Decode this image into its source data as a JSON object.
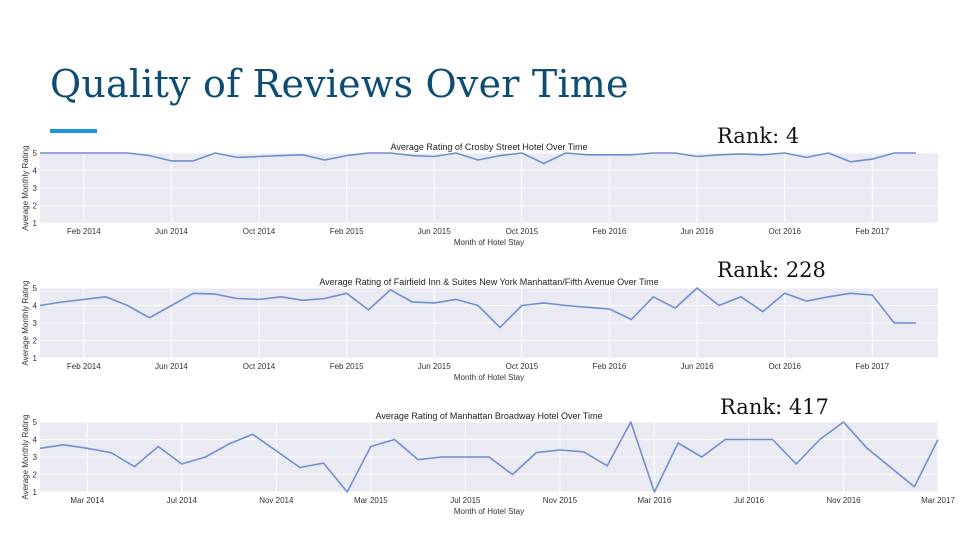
{
  "slide": {
    "title": "Quality of Reviews Over Time",
    "accent_color": "#1a9ad6",
    "title_color": "#0d4c73"
  },
  "ranks": [
    "Rank: 4",
    "Rank: 228",
    "Rank: 417"
  ],
  "chart_data": [
    {
      "type": "line",
      "title": "Average Rating of Crosby Street Hotel Over Time",
      "xlabel": "Month of Hotel Stay",
      "ylabel": "Average Monthly Rating",
      "ylim": [
        1,
        5
      ],
      "yticks": [
        1,
        2,
        3,
        4,
        5
      ],
      "xrange": [
        "2013-12",
        "2017-05"
      ],
      "xticks": [
        {
          "month": "2014-02",
          "label": "Feb 2014"
        },
        {
          "month": "2014-06",
          "label": "Jun 2014"
        },
        {
          "month": "2014-10",
          "label": "Oct 2014"
        },
        {
          "month": "2015-02",
          "label": "Feb 2015"
        },
        {
          "month": "2015-06",
          "label": "Jun 2015"
        },
        {
          "month": "2015-10",
          "label": "Oct 2015"
        },
        {
          "month": "2016-02",
          "label": "Feb 2016"
        },
        {
          "month": "2016-06",
          "label": "Jun 2016"
        },
        {
          "month": "2016-10",
          "label": "Oct 2016"
        },
        {
          "month": "2017-02",
          "label": "Feb 2017"
        }
      ],
      "grid": true,
      "line_color": "#6f8fce",
      "background": "#eaeaf2",
      "x": [
        "2013-12",
        "2014-01",
        "2014-02",
        "2014-03",
        "2014-04",
        "2014-05",
        "2014-06",
        "2014-07",
        "2014-08",
        "2014-09",
        "2014-10",
        "2014-11",
        "2014-12",
        "2015-01",
        "2015-02",
        "2015-03",
        "2015-04",
        "2015-05",
        "2015-06",
        "2015-07",
        "2015-08",
        "2015-09",
        "2015-10",
        "2015-11",
        "2015-12",
        "2016-01",
        "2016-02",
        "2016-03",
        "2016-04",
        "2016-05",
        "2016-06",
        "2016-07",
        "2016-08",
        "2016-09",
        "2016-10",
        "2016-11",
        "2016-12",
        "2017-01",
        "2017-02",
        "2017-03",
        "2017-04"
      ],
      "values": [
        5.0,
        5.0,
        5.0,
        5.0,
        5.0,
        4.85,
        4.55,
        4.55,
        5.0,
        4.75,
        4.8,
        4.85,
        4.9,
        4.6,
        4.85,
        5.0,
        5.0,
        4.85,
        4.8,
        5.0,
        4.6,
        4.85,
        5.0,
        4.4,
        5.0,
        4.9,
        4.9,
        4.9,
        5.0,
        5.0,
        4.8,
        4.9,
        4.95,
        4.9,
        5.0,
        4.75,
        5.0,
        4.5,
        4.65,
        5.0,
        5.0
      ]
    },
    {
      "type": "line",
      "title": "Average Rating of Fairfield Inn & Suites New York Manhattan/Fifth Avenue Over Time",
      "xlabel": "Month of Hotel Stay",
      "ylabel": "Average Monthly Rating",
      "ylim": [
        1,
        5
      ],
      "yticks": [
        1,
        2,
        3,
        4,
        5
      ],
      "xrange": [
        "2013-12",
        "2017-05"
      ],
      "xticks": [
        {
          "month": "2014-02",
          "label": "Feb 2014"
        },
        {
          "month": "2014-06",
          "label": "Jun 2014"
        },
        {
          "month": "2014-10",
          "label": "Oct 2014"
        },
        {
          "month": "2015-02",
          "label": "Feb 2015"
        },
        {
          "month": "2015-06",
          "label": "Jun 2015"
        },
        {
          "month": "2015-10",
          "label": "Oct 2015"
        },
        {
          "month": "2016-02",
          "label": "Feb 2016"
        },
        {
          "month": "2016-06",
          "label": "Jun 2016"
        },
        {
          "month": "2016-10",
          "label": "Oct 2016"
        },
        {
          "month": "2017-02",
          "label": "Feb 2017"
        }
      ],
      "grid": true,
      "line_color": "#6f8fce",
      "background": "#eaeaf2",
      "x": [
        "2013-12",
        "2014-01",
        "2014-02",
        "2014-03",
        "2014-04",
        "2014-05",
        "2014-06",
        "2014-07",
        "2014-08",
        "2014-09",
        "2014-10",
        "2014-11",
        "2014-12",
        "2015-01",
        "2015-02",
        "2015-03",
        "2015-04",
        "2015-05",
        "2015-06",
        "2015-07",
        "2015-08",
        "2015-09",
        "2015-10",
        "2015-11",
        "2015-12",
        "2016-01",
        "2016-02",
        "2016-03",
        "2016-04",
        "2016-05",
        "2016-06",
        "2016-07",
        "2016-08",
        "2016-09",
        "2016-10",
        "2016-11",
        "2016-12",
        "2017-01",
        "2017-02",
        "2017-03",
        "2017-04"
      ],
      "values": [
        4.0,
        4.2,
        4.35,
        4.5,
        4.0,
        3.3,
        4.0,
        4.7,
        4.65,
        4.4,
        4.35,
        4.5,
        4.3,
        4.4,
        4.7,
        3.75,
        4.9,
        4.2,
        4.15,
        4.35,
        4.0,
        2.75,
        4.0,
        4.15,
        4.0,
        3.9,
        3.8,
        3.2,
        4.5,
        3.85,
        5.0,
        4.0,
        4.5,
        3.65,
        4.7,
        4.25,
        4.5,
        4.7,
        4.6,
        3.0,
        3.0
      ]
    },
    {
      "type": "line",
      "title": "Average Rating of Manhattan Broadway Hotel Over Time",
      "xlabel": "Month of Hotel Stay",
      "ylabel": "Average Monthly Rating",
      "ylim": [
        1,
        5
      ],
      "yticks": [
        1,
        2,
        3,
        4,
        5
      ],
      "xrange": [
        "2014-01",
        "2017-03"
      ],
      "xticks": [
        {
          "month": "2014-03",
          "label": "Mar 2014"
        },
        {
          "month": "2014-07",
          "label": "Jul 2014"
        },
        {
          "month": "2014-11",
          "label": "Nov 2014"
        },
        {
          "month": "2015-03",
          "label": "Mar 2015"
        },
        {
          "month": "2015-07",
          "label": "Jul 2015"
        },
        {
          "month": "2015-11",
          "label": "Nov 2015"
        },
        {
          "month": "2016-03",
          "label": "Mar 2016"
        },
        {
          "month": "2016-07",
          "label": "Jul 2016"
        },
        {
          "month": "2016-11",
          "label": "Nov 2016"
        },
        {
          "month": "2017-03",
          "label": "Mar 2017"
        }
      ],
      "grid": true,
      "line_color": "#6f8fce",
      "background": "#eaeaf2",
      "x": [
        "2014-01",
        "2014-02",
        "2014-03",
        "2014-04",
        "2014-05",
        "2014-06",
        "2014-07",
        "2014-08",
        "2014-09",
        "2014-10",
        "2014-11",
        "2014-12",
        "2015-01",
        "2015-02",
        "2015-03",
        "2015-04",
        "2015-05",
        "2015-06",
        "2015-07",
        "2015-08",
        "2015-09",
        "2015-10",
        "2015-11",
        "2015-12",
        "2016-01",
        "2016-02",
        "2016-03",
        "2016-04",
        "2016-05",
        "2016-06",
        "2016-07",
        "2016-08",
        "2016-09",
        "2016-10",
        "2016-11",
        "2016-12",
        "2017-01",
        "2017-02",
        "2017-03"
      ],
      "values": [
        3.5,
        3.7,
        3.5,
        3.25,
        2.45,
        3.6,
        2.6,
        3.0,
        3.75,
        4.3,
        3.35,
        2.4,
        2.65,
        1.0,
        3.6,
        4.0,
        2.85,
        3.0,
        3.0,
        3.0,
        2.0,
        3.25,
        3.4,
        3.3,
        2.5,
        5.0,
        1.0,
        3.8,
        3.0,
        4.0,
        4.0,
        4.0,
        2.6,
        4.0,
        5.0,
        3.5,
        2.4,
        1.3,
        4.0
      ]
    }
  ]
}
